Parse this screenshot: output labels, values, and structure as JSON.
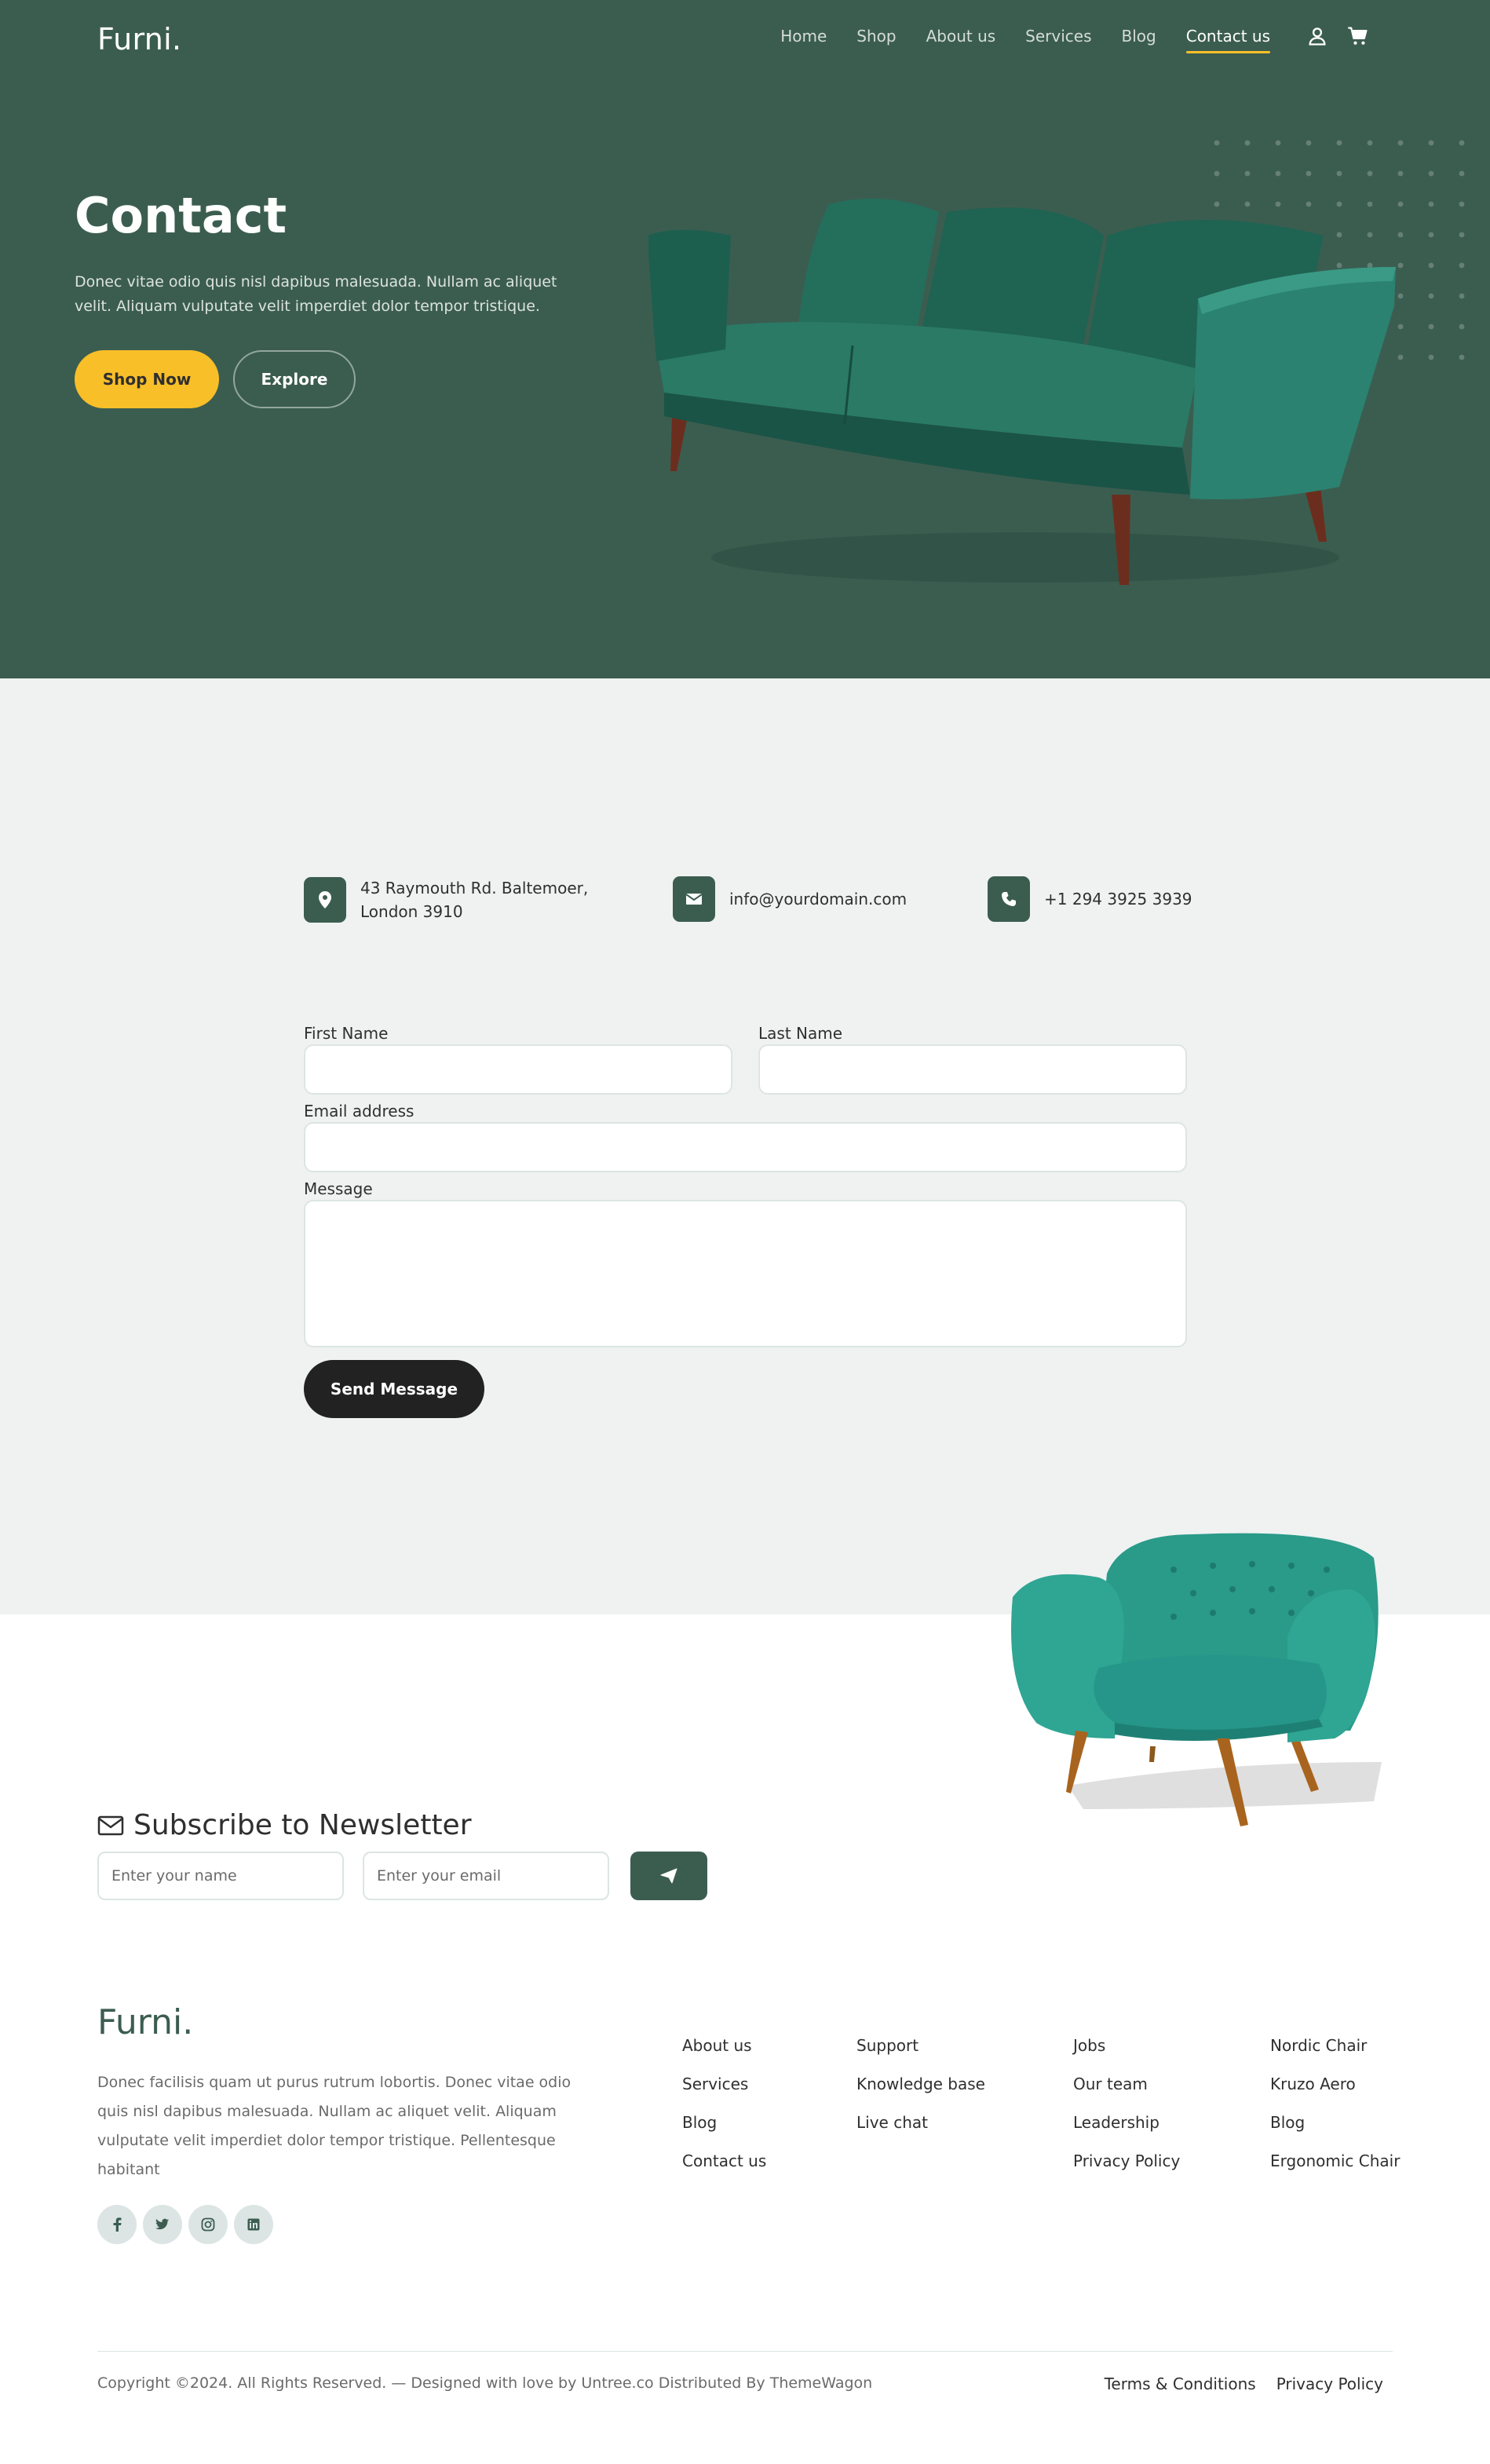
{
  "nav": {
    "brand": "Furni.",
    "links": [
      {
        "label": "Home"
      },
      {
        "label": "Shop"
      },
      {
        "label": "About us"
      },
      {
        "label": "Services"
      },
      {
        "label": "Blog"
      },
      {
        "label": "Contact us",
        "active": true
      }
    ],
    "icons": [
      "user-icon",
      "cart-icon"
    ]
  },
  "hero": {
    "title": "Contact",
    "text": "Donec vitae odio quis nisl dapibus malesuada. Nullam ac aliquet velit. Aliquam vulputate velit imperdiet dolor tempor tristique.",
    "primary_button": "Shop Now",
    "secondary_button": "Explore"
  },
  "contact_info": {
    "address": "43 Raymouth Rd. Baltemoer, London 3910",
    "email": "info@yourdomain.com",
    "phone": "+1 294 3925 3939"
  },
  "form": {
    "first_name_label": "First Name",
    "last_name_label": "Last Name",
    "email_label": "Email address",
    "message_label": "Message",
    "first_name_value": "",
    "last_name_value": "",
    "email_value": "",
    "message_value": "",
    "submit_label": "Send Message"
  },
  "newsletter": {
    "title": "Subscribe to Newsletter",
    "name_placeholder": "Enter your name",
    "email_placeholder": "Enter your email"
  },
  "footer": {
    "brand": "Furni.",
    "text": "Donec facilisis quam ut purus rutrum lobortis. Donec vitae odio quis nisl dapibus malesuada. Nullam ac aliquet velit. Aliquam vulputate velit imperdiet dolor tempor tristique. Pellentesque habitant",
    "socials": [
      "facebook-icon",
      "twitter-icon",
      "instagram-icon",
      "linkedin-icon"
    ],
    "col1": [
      "About us",
      "Services",
      "Blog",
      "Contact us"
    ],
    "col2": [
      "Support",
      "Knowledge base",
      "Live chat"
    ],
    "col3": [
      "Jobs",
      "Our team",
      "Leadership",
      "Privacy Policy"
    ],
    "col4": [
      "Nordic Chair",
      "Kruzo Aero",
      "Blog",
      "Ergonomic Chair"
    ],
    "copyright": "Copyright ©2024. All Rights Reserved. — Designed with love by Untree.co Distributed By ThemeWagon",
    "legal": [
      "Terms & Conditions",
      "Privacy Policy"
    ]
  },
  "colors": {
    "primary_green": "#3b5d50",
    "accent_yellow": "#f9bf29",
    "dark_button": "#222222",
    "light_bg": "#eff2f1"
  }
}
